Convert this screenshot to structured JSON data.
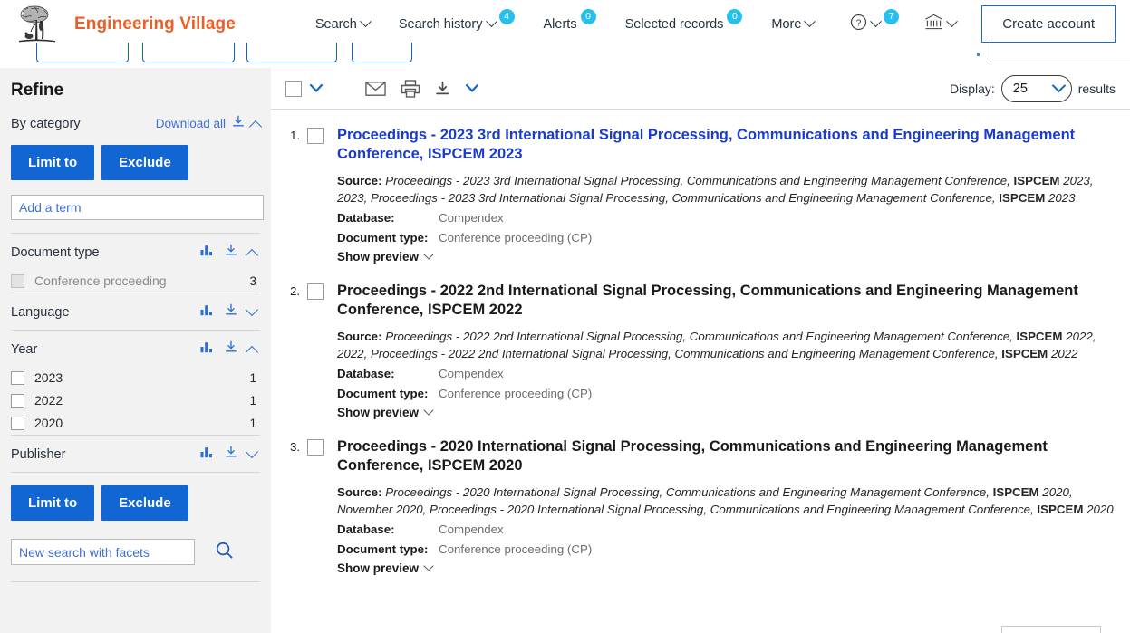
{
  "header": {
    "brand": "Engineering Village",
    "logo_icon": "tree-engraving-logo",
    "nav": [
      {
        "label": "Search",
        "caret": true,
        "badge": null
      },
      {
        "label": "Search history",
        "caret": true,
        "badge": "4"
      },
      {
        "label": "Alerts",
        "caret": false,
        "badge": "0"
      },
      {
        "label": "Selected records",
        "caret": false,
        "badge": "0"
      },
      {
        "label": "More",
        "caret": true,
        "badge": null
      }
    ],
    "help_icon": "question-circle-icon",
    "help_badge": "7",
    "institution_icon": "institution-bank-icon",
    "create_account_label": "Create account"
  },
  "sidebar": {
    "title": "Refine",
    "by_category_label": "By category",
    "download_all_label": "Download all",
    "download_icon": "download-icon",
    "collapse_icon": "chevron-up-icon",
    "limit_to_label": "Limit to",
    "exclude_label": "Exclude",
    "add_term_placeholder": "Add a term",
    "facets": [
      {
        "name": "Document type",
        "expanded": true,
        "chart_icon": "bar-chart-icon",
        "download_icon": "download-icon",
        "toggle_icon": "chevron-up-icon",
        "rows": [
          {
            "label": "Conference proceeding",
            "count": "3",
            "disabled": true
          }
        ]
      },
      {
        "name": "Language",
        "expanded": false,
        "chart_icon": "bar-chart-icon",
        "download_icon": "download-icon",
        "toggle_icon": "chevron-down-icon",
        "rows": []
      },
      {
        "name": "Year",
        "expanded": true,
        "chart_icon": "bar-chart-icon",
        "download_icon": "download-icon",
        "toggle_icon": "chevron-up-icon",
        "rows": [
          {
            "label": "2023",
            "count": "1",
            "disabled": false
          },
          {
            "label": "2022",
            "count": "1",
            "disabled": false
          },
          {
            "label": "2020",
            "count": "1",
            "disabled": false
          }
        ]
      },
      {
        "name": "Publisher",
        "expanded": false,
        "chart_icon": "bar-chart-icon",
        "download_icon": "download-icon",
        "toggle_icon": "chevron-down-icon",
        "rows": []
      }
    ],
    "bottom_limit_to_label": "Limit to",
    "bottom_exclude_label": "Exclude",
    "new_search_placeholder": "New search with facets",
    "search_icon": "search-magnifier-icon"
  },
  "toolbar": {
    "select_all_checkbox": "select-all-checkbox",
    "select_all_caret": "chevron-down-icon",
    "email_icon": "email-envelope-icon",
    "print_icon": "printer-icon",
    "download_icon": "download-icon",
    "download_caret": "chevron-down-icon",
    "display_label": "Display:",
    "display_value": "25",
    "results_label": "results"
  },
  "results": [
    {
      "number": "1.",
      "title_main": "Proceedings - 2023 3rd International Signal Processing, Communications and Engineering Management Conference,",
      "title_tail_bold": "ISPCEM",
      "title_tail_rest": "2023",
      "visited": false,
      "source_label": "Source:",
      "source_parts": [
        {
          "text": "Proceedings - 2023 3rd International Signal Processing, Communications and Engineering Management Conference, ",
          "bold": false
        },
        {
          "text": "ISPCEM",
          "bold": true
        },
        {
          "text": " 2023, 2023, Proceedings - 2023 3rd International Signal Processing, Communications and Engineering Management Conference, ",
          "bold": false
        },
        {
          "text": "ISPCEM",
          "bold": true
        },
        {
          "text": " 2023",
          "bold": false
        }
      ],
      "database_key": "Database:",
      "database_val": "Compendex",
      "doctype_key": "Document type:",
      "doctype_val": "Conference proceeding (CP)",
      "show_preview_label": "Show preview"
    },
    {
      "number": "2.",
      "title_main": "Proceedings - 2022 2nd International Signal Processing, Communications and Engineering Management Conference, ISPCEM 2022",
      "title_tail_bold": "",
      "title_tail_rest": "",
      "visited": true,
      "source_label": "Source:",
      "source_parts": [
        {
          "text": "Proceedings - 2022 2nd International Signal Processing, Communications and Engineering Management Conference, ",
          "bold": false
        },
        {
          "text": "ISPCEM",
          "bold": true
        },
        {
          "text": " 2022, 2022, Proceedings - 2022 2nd International Signal Processing, Communications and Engineering Management Conference, ",
          "bold": false
        },
        {
          "text": "ISPCEM",
          "bold": true
        },
        {
          "text": " 2022",
          "bold": false
        }
      ],
      "database_key": "Database:",
      "database_val": "Compendex",
      "doctype_key": "Document type:",
      "doctype_val": "Conference proceeding (CP)",
      "show_preview_label": "Show preview"
    },
    {
      "number": "3.",
      "title_main": "Proceedings - 2020 International Signal Processing, Communications and Engineering Management Conference, ISPCEM 2020",
      "title_tail_bold": "",
      "title_tail_rest": "",
      "visited": true,
      "source_label": "Source:",
      "source_parts": [
        {
          "text": "Proceedings - 2020 International Signal Processing, Communications and Engineering Management Conference, ",
          "bold": false
        },
        {
          "text": "ISPCEM",
          "bold": true
        },
        {
          "text": " 2020, November 2020, Proceedings - 2020 International Signal Processing, Communications and Engineering Management Conference, ",
          "bold": false
        },
        {
          "text": "ISPCEM",
          "bold": true
        },
        {
          "text": " 2020",
          "bold": false
        }
      ],
      "database_key": "Database:",
      "database_val": "Compendex",
      "doctype_key": "Document type:",
      "doctype_val": "Conference proceeding (CP)",
      "show_preview_label": "Show preview"
    }
  ],
  "colors": {
    "brand_orange": "#eb5f28",
    "link_blue": "#1a3ccc",
    "button_blue": "#1266d4",
    "badge_cyan": "#27c0ee",
    "sidebar_bg": "#f2f2f2",
    "facet_link_blue": "#3f6fd4"
  }
}
